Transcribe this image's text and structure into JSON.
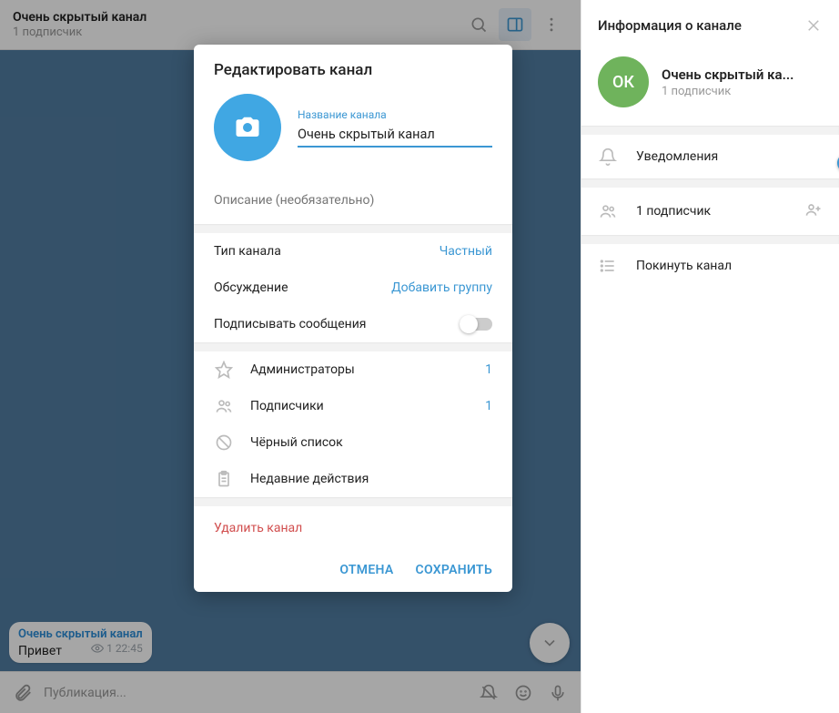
{
  "header": {
    "title": "Очень скрытый канал",
    "subscribers": "1 подписчик"
  },
  "message": {
    "channel": "Очень скрытый канал",
    "text": "Привет",
    "views": "1",
    "time": "22:45"
  },
  "compose": {
    "placeholder": "Публикация..."
  },
  "modal": {
    "title": "Редактировать канал",
    "name_label": "Название канала",
    "name_value": "Очень скрытый канал",
    "desc_placeholder": "Описание (необязательно)",
    "rows": {
      "type_label": "Тип канала",
      "type_value": "Частный",
      "discuss_label": "Обсуждение",
      "discuss_value": "Добавить группу",
      "sign_label": "Подписывать сообщения"
    },
    "mgmt": {
      "admins": "Администраторы",
      "admins_count": "1",
      "subs": "Подписчики",
      "subs_count": "1",
      "blacklist": "Чёрный список",
      "recent": "Недавние действия"
    },
    "delete": "Удалить канал",
    "cancel": "ОТМЕНА",
    "save": "СОХРАНИТЬ"
  },
  "sidebar": {
    "title": "Информация о канале",
    "avatar_text": "ОК",
    "name": "Очень скрытый ка...",
    "subs": "1 подписчик",
    "notif": "Уведомления",
    "members": "1 подписчик",
    "leave": "Покинуть канал"
  }
}
